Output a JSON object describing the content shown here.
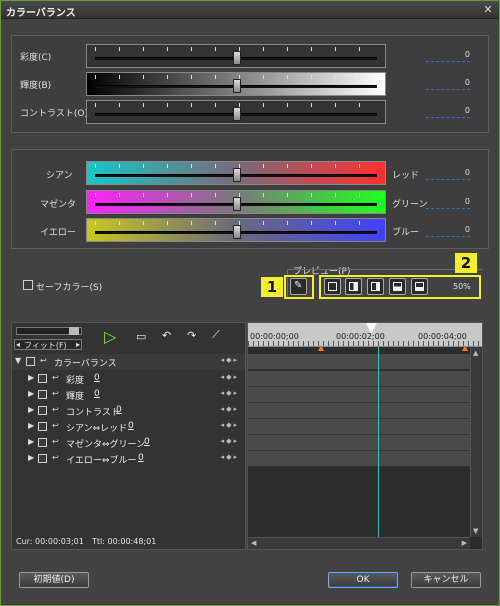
{
  "window": {
    "title": "カラーバランス",
    "close_icon": "close-icon"
  },
  "basic": {
    "rows": [
      {
        "label": "彩度(C)",
        "value": "0",
        "level": 0.5
      },
      {
        "label": "輝度(B)",
        "value": "0",
        "level": 0.5
      },
      {
        "label": "コントラスト(O)",
        "value": "0",
        "level": 0.5
      }
    ]
  },
  "color": {
    "rows": [
      {
        "left": "シアン",
        "right": "レッド",
        "value": "0",
        "level": 0.5
      },
      {
        "left": "マゼンタ",
        "right": "グリーン",
        "value": "0",
        "level": 0.5
      },
      {
        "left": "イエロー",
        "right": "ブルー",
        "value": "0",
        "level": 0.5
      }
    ]
  },
  "safe_color": {
    "label": "セーフカラー(S)"
  },
  "preview": {
    "label": "プレビュー(P)",
    "zoom": "50%",
    "callout_1": "1",
    "callout_2": "2"
  },
  "timeline": {
    "fit_label": "フィット(F)",
    "times": [
      "00:00:00;00",
      "00:00:02;00",
      "00:00:04;00"
    ],
    "tracks": [
      {
        "label": "カラーバランス",
        "value": ""
      },
      {
        "label": "彩度",
        "value": "0"
      },
      {
        "label": "輝度",
        "value": "0"
      },
      {
        "label": "コントラスト",
        "value": "0"
      },
      {
        "label": "シアン⇔レッド",
        "value": "0"
      },
      {
        "label": "マゼンタ⇔グリーン",
        "value": "0"
      },
      {
        "label": "イエロー⇔ブルー",
        "value": "0"
      }
    ],
    "cur": "Cur: 00:00:03;01",
    "ttl": "Ttl: 00:00:48;01"
  },
  "buttons": {
    "reset": "初期値(D)",
    "ok": "OK",
    "cancel": "キャンセル"
  },
  "colors": {
    "accent": "#f5ee2a",
    "playhead": "#3fbfb0",
    "focus": "#3b6dbd"
  }
}
